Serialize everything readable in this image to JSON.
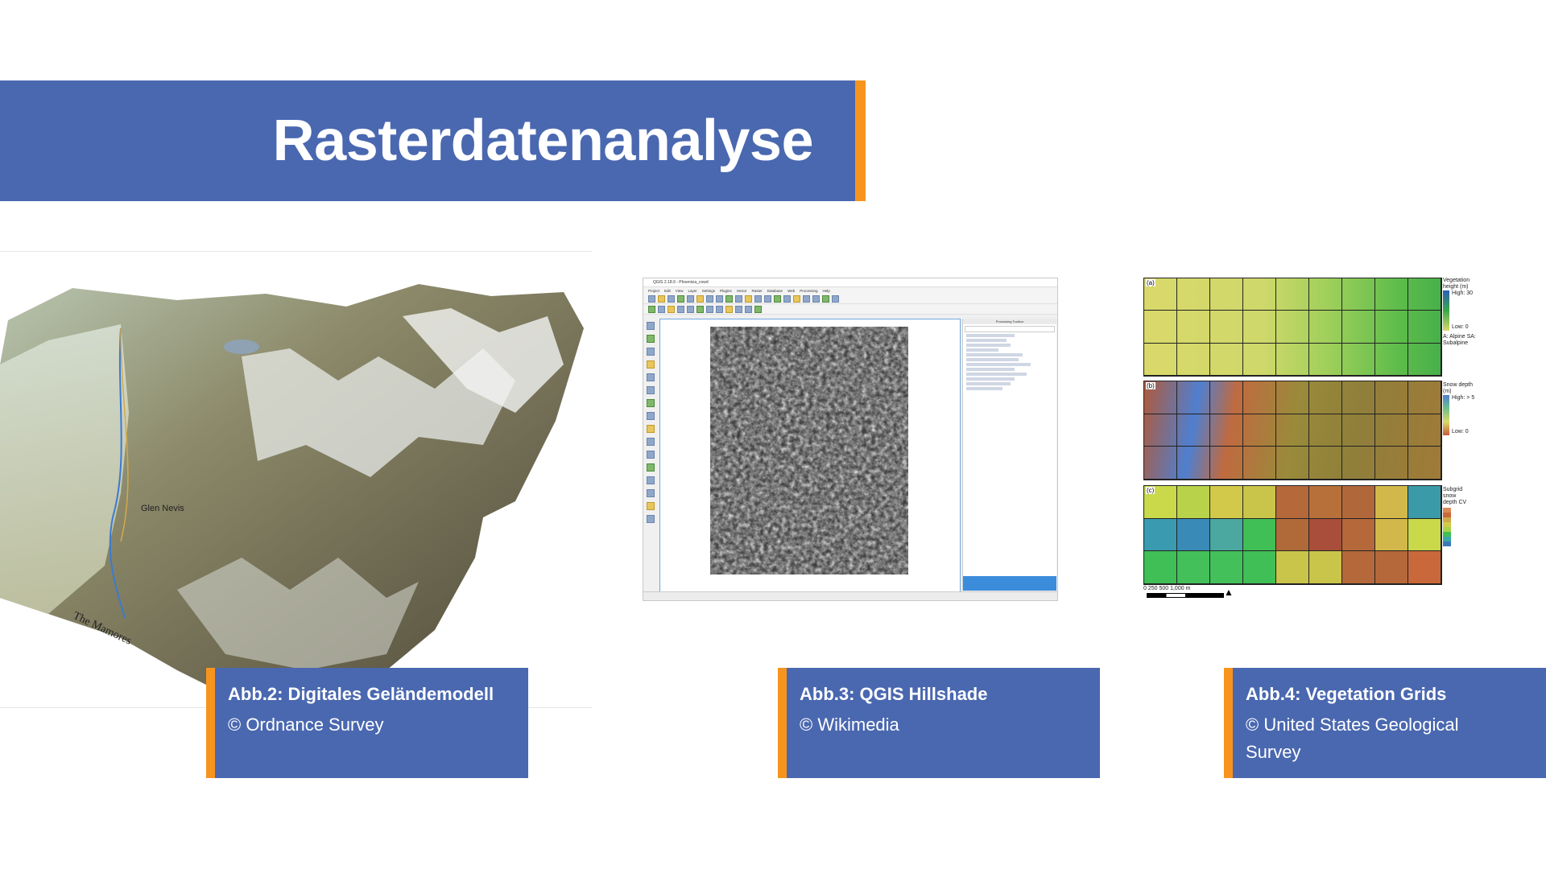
{
  "slide": {
    "title": "Rasterdatenanalyse"
  },
  "colors": {
    "banner_blue": "#4a68b0",
    "accent_orange": "#f7941d"
  },
  "figures": [
    {
      "caption_title": "Abb.2: Digitales Geländemodell",
      "caption_credit": "© Ordnance Survey",
      "image_labels": [
        "Glen Nevis",
        "The Mamores"
      ]
    },
    {
      "caption_title": "Abb.3: QGIS Hillshade",
      "caption_credit": "© Wikimedia"
    },
    {
      "caption_title": "Abb.4: Vegetation Grids",
      "caption_credit": "© United States Geological Survey"
    }
  ],
  "grids": {
    "panel_a_tag": "(a)",
    "panel_b_tag": "(b)",
    "panel_c_tag": "(c)",
    "legend_a_title": "Vegetation height (m)",
    "legend_a_high": "High: 30",
    "legend_a_low": "Low: 0",
    "legend_a_classes": "A: Alpine SA: Subalpine",
    "legend_b_title": "Snow depth (m)",
    "legend_b_high": "High: > 5",
    "legend_b_low": "Low: 0",
    "legend_c_title": "Subgrid snow depth CV",
    "scale_label": "0   250  500        1,000",
    "scale_unit": "m"
  }
}
